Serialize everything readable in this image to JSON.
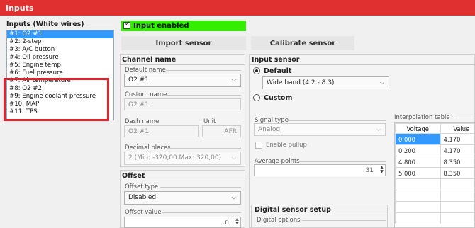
{
  "title": "Inputs",
  "inputs_group": {
    "title": "Inputs (White wires)",
    "items": [
      "#1: O2 #1",
      "#2: 2-step",
      "#3: A/C button",
      "#4: Oil pressure",
      "#5: Engine temp.",
      "#6: Fuel pressure",
      "#7: Air temperature",
      "#8: O2 #2",
      "#9: Engine coolant pressure",
      "#10: MAP",
      "#11: TPS"
    ],
    "selected_index": 0
  },
  "input_enabled": {
    "label": "Input enabled",
    "checked": true,
    "color": "#33ee00"
  },
  "buttons": {
    "import": "Import sensor",
    "calibrate": "Calibrate sensor"
  },
  "channel": {
    "title": "Channel name",
    "default_name_label": "Default name",
    "default_name_value": "O2 #1",
    "custom_name_label": "Custom name",
    "custom_name_placeholder": "O2 #1",
    "dash_name_label": "Dash name",
    "dash_name_value": "O2 #1",
    "unit_label": "Unit",
    "unit_value": "AFR",
    "decimal_label": "Decimal places",
    "decimal_value": "2 (Min: -320,00 Max: 320,00)"
  },
  "offset": {
    "title": "Offset",
    "type_label": "Offset type",
    "type_value": "Disabled",
    "value_label": "Offset value",
    "value": "0"
  },
  "input_sensor": {
    "title": "Input sensor",
    "default_label": "Default",
    "default_value": "Wide band (4.2 - 8.3)",
    "custom_label": "Custom",
    "signal_type_label": "Signal type",
    "signal_type_value": "Analog",
    "pullup_label": "Enable pullup",
    "avg_points_label": "Average points",
    "avg_points_value": "31"
  },
  "interpolation": {
    "title": "Interpolation  table",
    "headers": [
      "Voltage",
      "Value"
    ],
    "rows": [
      [
        "0.000",
        "4.170"
      ],
      [
        "0.200",
        "4.170"
      ],
      [
        "4.800",
        "8.350"
      ],
      [
        "5.000",
        "8.350"
      ],
      [
        "",
        ""
      ],
      [
        "",
        ""
      ],
      [
        "",
        ""
      ],
      [
        "",
        ""
      ]
    ]
  },
  "digital": {
    "title": "Digital sensor setup",
    "options_label": "Digital options"
  },
  "highlight_color": "#e8202a"
}
